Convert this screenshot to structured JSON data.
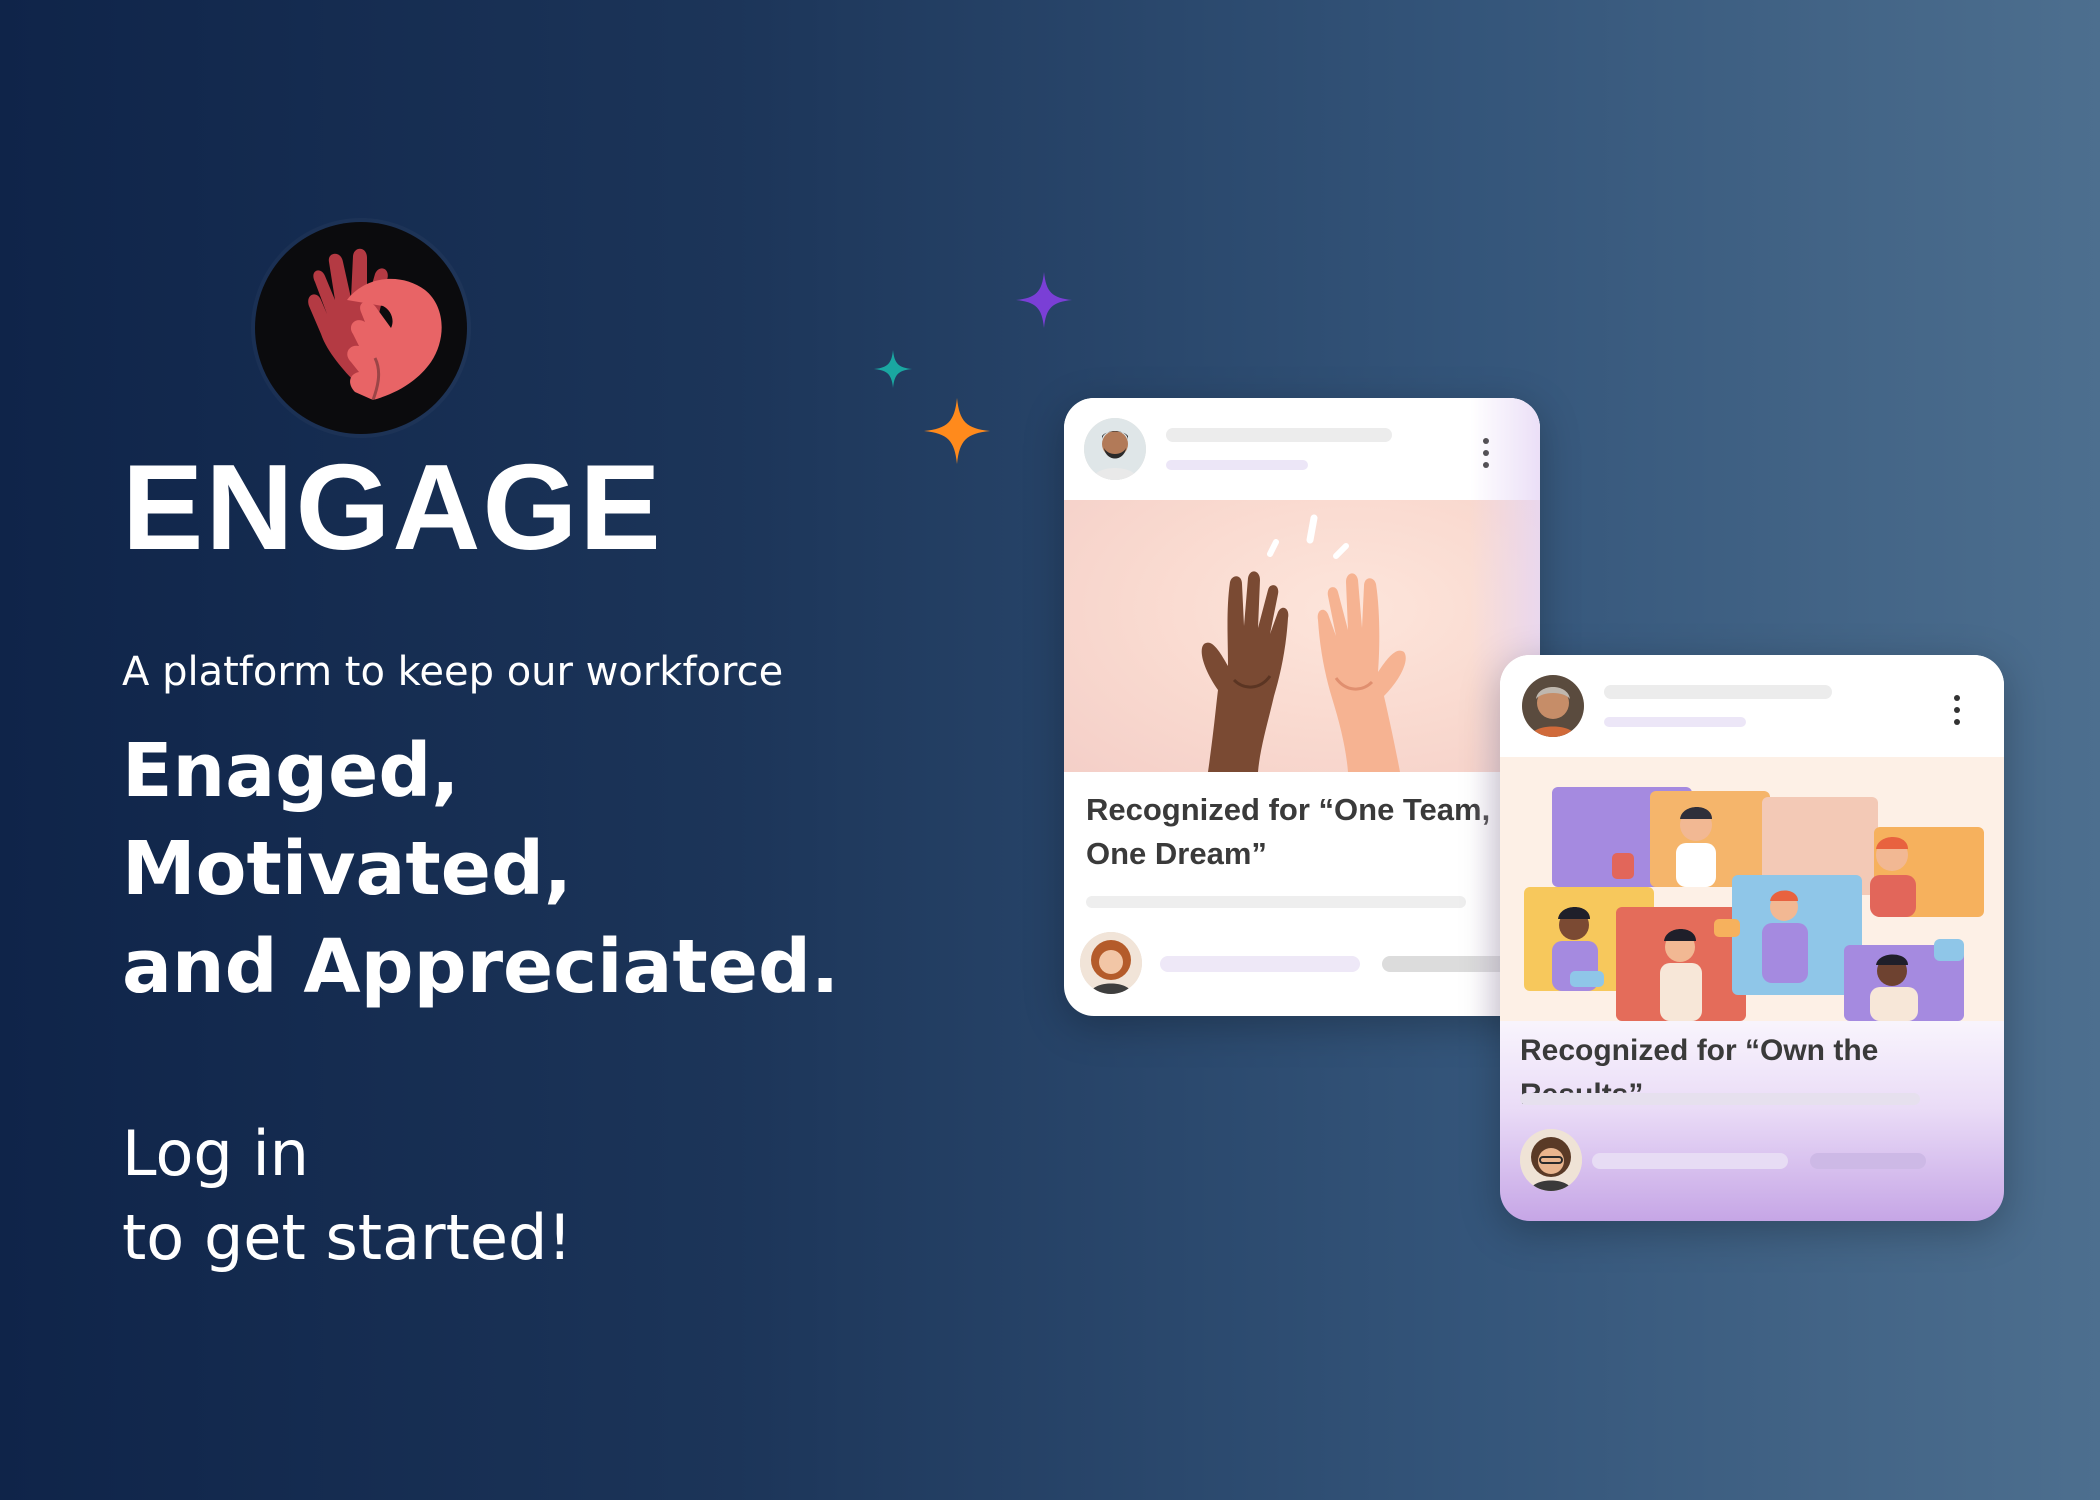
{
  "brand": {
    "name": "ENGAGE",
    "logo_icon": "hands-heart-icon",
    "colors": {
      "logo_bg": "#0b0b0d",
      "hand_dark": "#b43a43",
      "hand_light": "#e86466"
    }
  },
  "hero": {
    "tagline": "A platform to keep our workforce",
    "headline": [
      "Enaged,",
      "Motivated,",
      "and Appreciated."
    ],
    "cta": [
      "Log in",
      "to get started!"
    ]
  },
  "sparkles": [
    {
      "icon": "sparkle-purple-icon",
      "color": "#7a3fd6"
    },
    {
      "icon": "sparkle-teal-icon",
      "color": "#1aa7a1"
    },
    {
      "icon": "sparkle-orange-icon",
      "color": "#ff8a1c"
    }
  ],
  "cards": [
    {
      "recognition_text": "Recognized for “One Team, One Dream”",
      "image_icon": "high-five-illustration",
      "author_avatar": "man-avatar",
      "commenter_avatar": "woman-avatar"
    },
    {
      "recognition_text": "Recognized for “Own the Results”",
      "image_icon": "team-celebration-illustration",
      "author_avatar": "woman-avatar",
      "commenter_avatar": "man-avatar"
    }
  ]
}
